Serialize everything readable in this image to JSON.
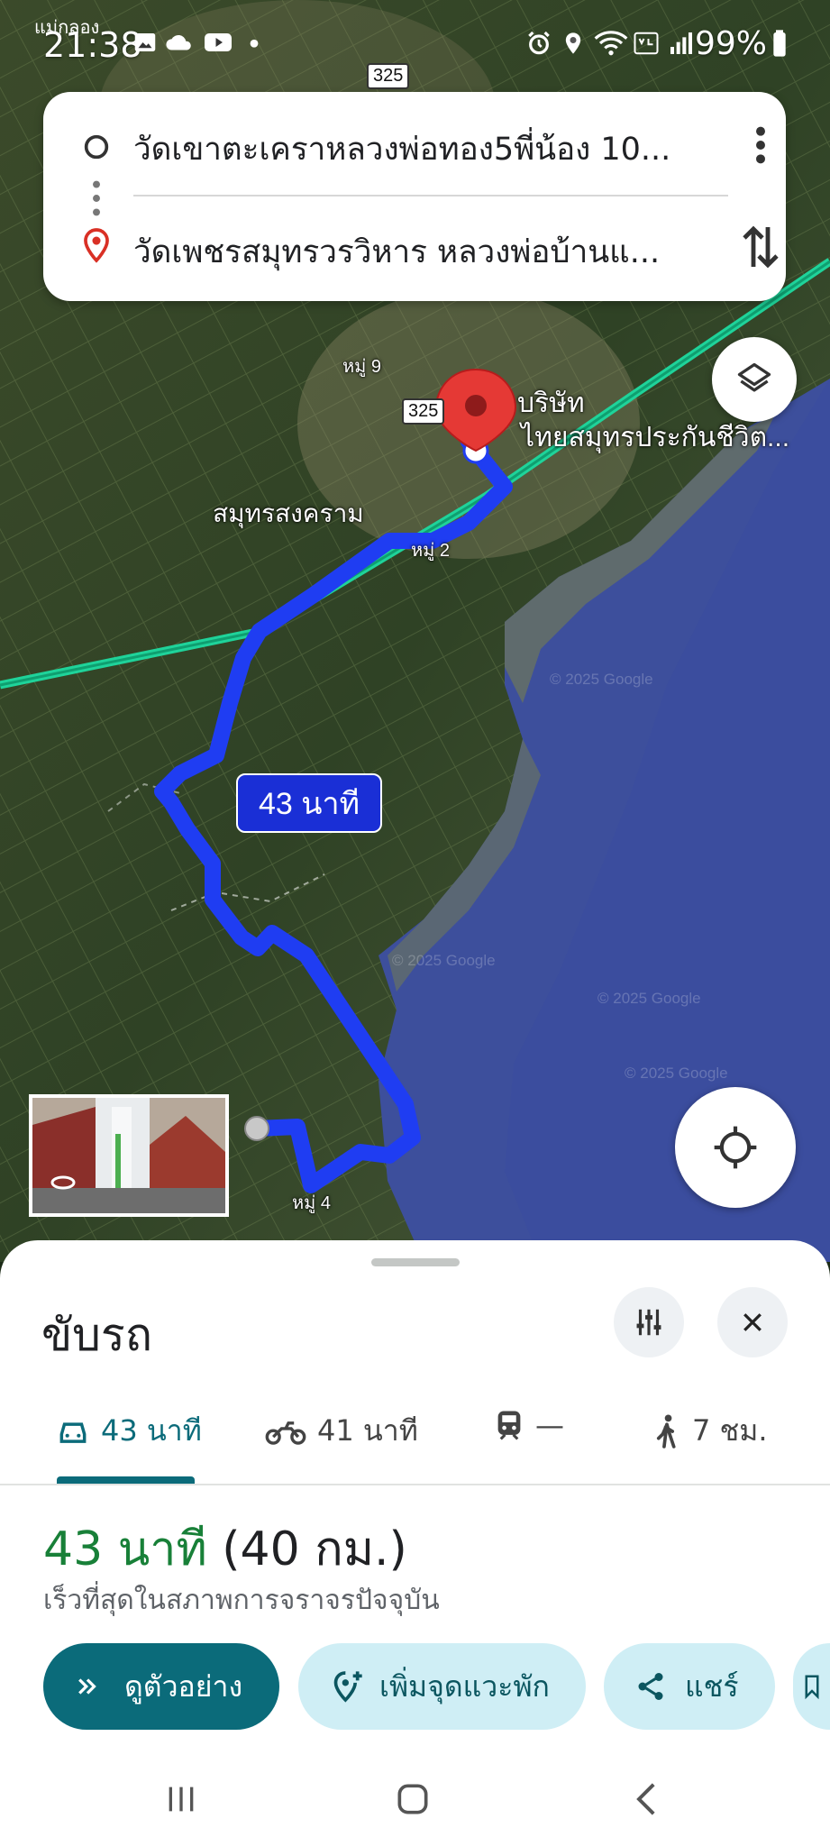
{
  "status_bar": {
    "carrier": "แม่กลอง",
    "time": "21:38",
    "battery": "99%"
  },
  "route_card": {
    "origin": "วัดเขาตะเคราหลวงพ่อทอง5พี่น้อง 10...",
    "destination": "วัดเพชรสมุทรวรวิหาร หลวงพ่อบ้านแ..."
  },
  "map": {
    "road_shield_top": "325",
    "road_shield_mid": "325",
    "labels": {
      "moo9": "หมู่ 9",
      "company_line1": "บริษัท",
      "company_line2": "ไทยสมุทรประกันชีวิต...",
      "province": "สมุทรสงคราม",
      "moo2": "หมู่ 2",
      "moo4": "หมู่ 4"
    },
    "route_time_chip": "43 นาที",
    "watermark": "© 2025 Google",
    "route_color": "#1f3df2",
    "water_color": "#3d4f9c"
  },
  "sheet": {
    "title": "ขับรถ",
    "modes": [
      {
        "icon": "car-icon",
        "label": "43 นาที"
      },
      {
        "icon": "motorcycle-icon",
        "label": "41 นาที"
      },
      {
        "icon": "train-icon",
        "label": "—"
      },
      {
        "icon": "walk-icon",
        "label": "7 ชม."
      }
    ],
    "summary_time": "43 นาที",
    "summary_distance": "(40 กม.)",
    "summary_sub": "เร็วที่สุดในสภาพการจราจรปัจจุบัน",
    "actions": {
      "preview": "ดูตัวอย่าง",
      "add_stop": "เพิ่มจุดแวะพัก",
      "share": "แชร์"
    },
    "accent_color": "#0b6b7a",
    "time_color": "#188038"
  }
}
